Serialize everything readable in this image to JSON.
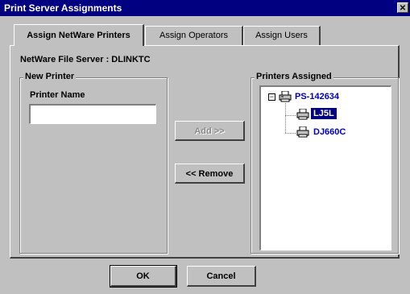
{
  "window": {
    "title": "Print Server Assignments",
    "close_glyph": "✕"
  },
  "tabs": [
    {
      "label": "Assign NetWare Printers",
      "active": true
    },
    {
      "label": "Assign Operators",
      "active": false
    },
    {
      "label": "Assign Users",
      "active": false
    }
  ],
  "server_label": "NetWare File Server : DLINKTC",
  "new_printer": {
    "group_title": "New Printer",
    "field_label": "Printer Name",
    "field_value": ""
  },
  "buttons": {
    "add": "Add >>",
    "remove": "<< Remove",
    "ok": "OK",
    "cancel": "Cancel"
  },
  "assigned": {
    "group_title": "Printers Assigned",
    "expander_glyph": "−",
    "root": {
      "label": "PS-142634",
      "icon": "printer-server-icon"
    },
    "children": [
      {
        "label": "LJ5L",
        "icon": "printer-icon",
        "selected": true
      },
      {
        "label": "DJ660C",
        "icon": "printer-icon",
        "selected": false
      }
    ]
  },
  "colors": {
    "title_bar": "#000080",
    "tree_text": "#0000c0",
    "selection": "#000080",
    "face": "#c0c0c0"
  }
}
